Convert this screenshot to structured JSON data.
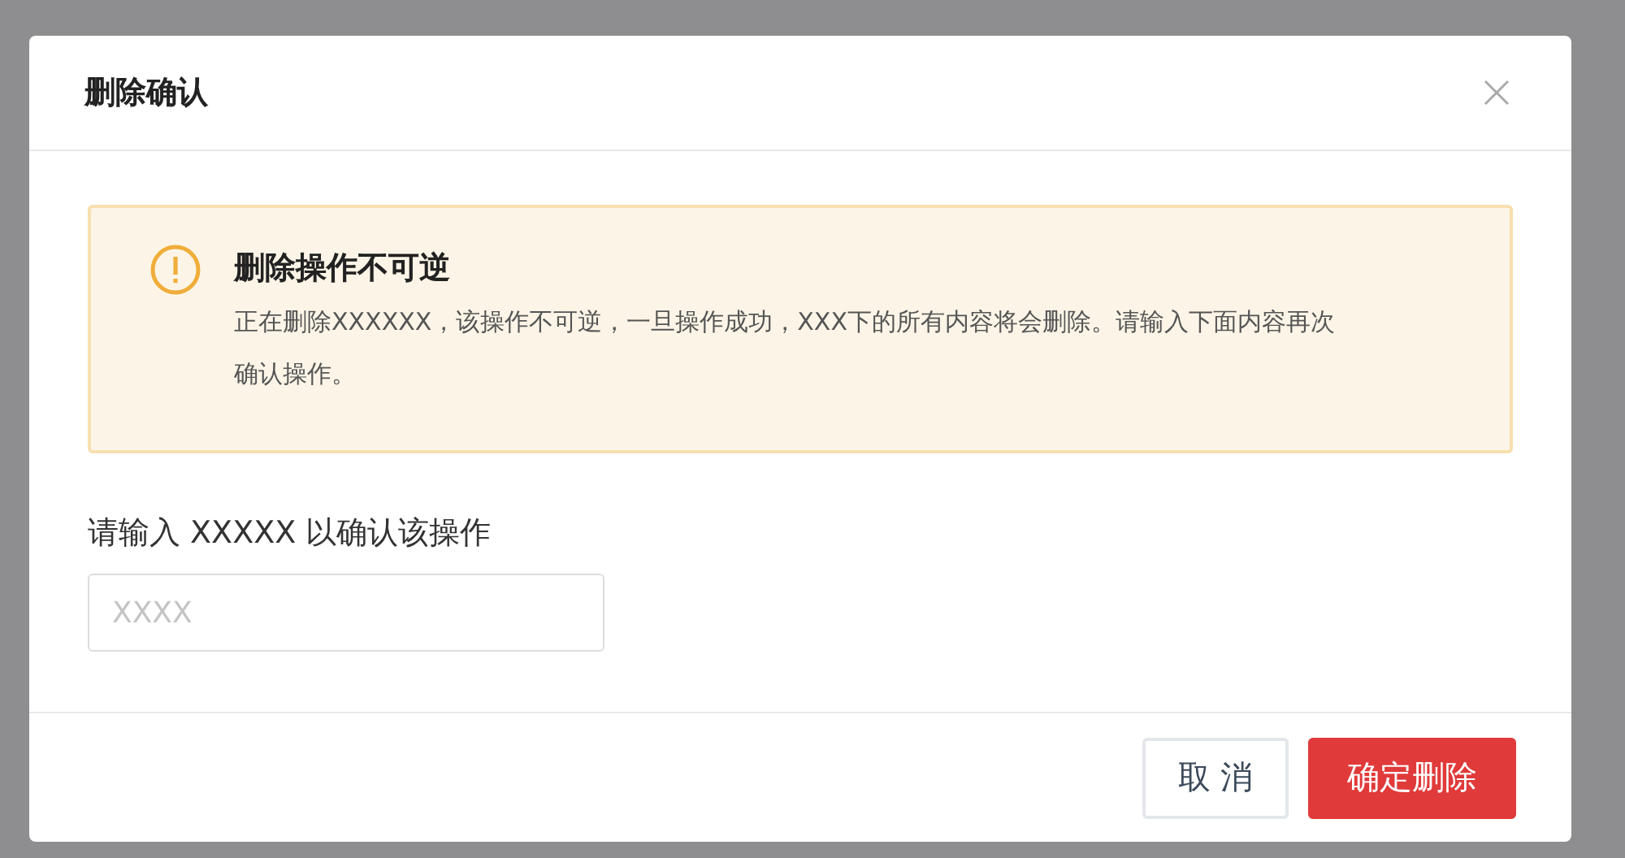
{
  "dialog": {
    "title": "删除确认",
    "alert": {
      "title": "删除操作不可逆",
      "message": "正在删除XXXXXX，该操作不可逆，一旦操作成功，XXX下的所有内容将会删除。请输入下面内容再次确认操作。"
    },
    "field": {
      "label": "请输入 XXXXX 以确认该操作",
      "placeholder": "XXXX"
    },
    "buttons": [
      {
        "label": "取 消",
        "kind": "secondary"
      },
      {
        "label": "确定删除",
        "kind": "danger"
      }
    ]
  }
}
